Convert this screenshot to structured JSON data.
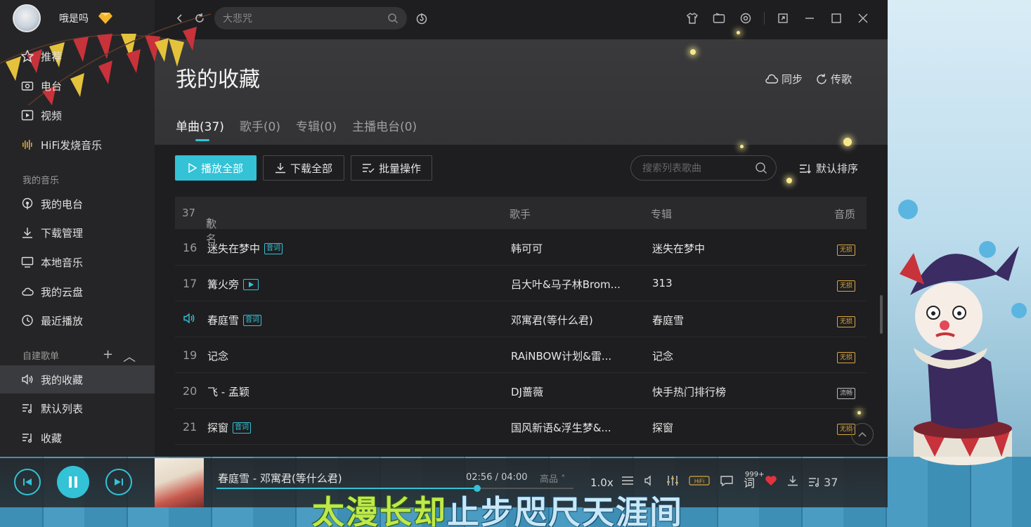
{
  "profile": {
    "username": "哦是吗"
  },
  "search": {
    "placeholder": "大悲咒"
  },
  "sidebar": {
    "nav": [
      {
        "label": "推荐",
        "icon": "star-icon"
      },
      {
        "label": "电台",
        "icon": "radio-icon"
      },
      {
        "label": "视频",
        "icon": "video-icon"
      },
      {
        "label": "HiFi发烧音乐",
        "icon": "waveform-icon"
      }
    ],
    "my_music_title": "我的音乐",
    "my_music": [
      {
        "label": "我的电台",
        "icon": "podcast-icon"
      },
      {
        "label": "下载管理",
        "icon": "download-icon"
      },
      {
        "label": "本地音乐",
        "icon": "monitor-icon"
      },
      {
        "label": "我的云盘",
        "icon": "cloud-icon"
      },
      {
        "label": "最近播放",
        "icon": "clock-icon"
      }
    ],
    "playlists_title": "自建歌单",
    "playlists": [
      {
        "label": "我的收藏",
        "icon": "speaker-icon"
      },
      {
        "label": "默认列表",
        "icon": "playlist-icon"
      },
      {
        "label": "收藏",
        "icon": "playlist-icon"
      }
    ]
  },
  "page": {
    "title": "我的收藏",
    "sync_label": "同步",
    "upload_label": "传歌",
    "tabs": [
      {
        "label": "单曲(37)"
      },
      {
        "label": "歌手(0)"
      },
      {
        "label": "专辑(0)"
      },
      {
        "label": "主播电台(0)"
      }
    ],
    "toolbar": {
      "play_all": "播放全部",
      "download_all": "下载全部",
      "batch": "批量操作",
      "search_placeholder": "搜索列表歌曲",
      "sort": "默认排序"
    },
    "table": {
      "count": "37",
      "headers": {
        "name": "歌名",
        "artist": "歌手",
        "album": "专辑",
        "quality": "音质"
      },
      "rows": [
        {
          "num": "16",
          "title": "迷失在梦中",
          "tag": "lyric",
          "artist": "韩可可",
          "album": "迷失在梦中",
          "quality": "无损"
        },
        {
          "num": "17",
          "title": "篝火旁",
          "tag": "mv",
          "artist": "吕大叶&马子林Brom...",
          "album": "313",
          "quality": "无损"
        },
        {
          "num": "",
          "title": "春庭雪",
          "tag": "lyric",
          "playing": true,
          "artist": "邓寓君(等什么君)",
          "album": "春庭雪",
          "quality": "无损"
        },
        {
          "num": "19",
          "title": "记念",
          "tag": "",
          "artist": "RAiNBOW计划&雷...",
          "album": "记念",
          "quality": "无损"
        },
        {
          "num": "20",
          "title": "飞 - 孟颖",
          "tag": "",
          "artist": "DJ蔷薇",
          "album": "快手热门排行榜",
          "quality": "流畅"
        },
        {
          "num": "21",
          "title": "探窗",
          "tag": "lyric",
          "artist": "国风新语&浮生梦&...",
          "album": "探窗",
          "quality": "无损"
        }
      ]
    }
  },
  "player": {
    "now_playing": "春庭雪 - 邓寓君(等什么君)",
    "time": "02:56 / 04:00",
    "quality": "高品",
    "progress": 0.73,
    "speed": "1.0x",
    "comments": "999+",
    "lyrics_label": "词",
    "playlist_count": "37"
  },
  "lyrics": {
    "sung": "太漫长却",
    "unsung": "止步咫尺天涯间"
  },
  "colors": {
    "accent": "#33c2d6",
    "lossless": "#d9a640"
  }
}
